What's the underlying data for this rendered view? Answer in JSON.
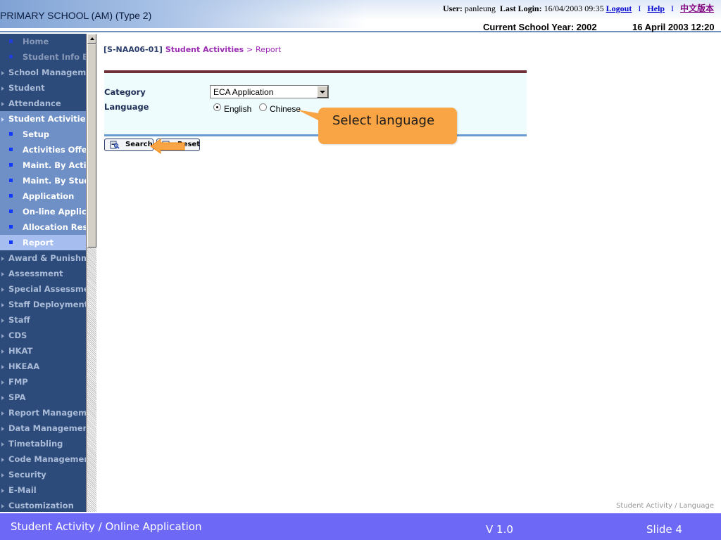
{
  "header": {
    "school_title": "PRIMARY SCHOOL (AM) (Type 2)",
    "user_label": "User:",
    "user_name": "panleung",
    "last_login_label": "Last Login:",
    "last_login_value": "16/04/2003 09:35",
    "logout": "Logout",
    "separator": "I",
    "help": "Help",
    "chinese_version": "中文版本",
    "current_school_year": "Current School Year: 2002",
    "date_time": "16 April 2003 12:20"
  },
  "sidebar": {
    "items": [
      {
        "label": "Home",
        "level": "sub",
        "state": "faded"
      },
      {
        "label": "Student Info Enqu",
        "level": "sub",
        "state": "faded"
      },
      {
        "label": "School Managemen",
        "level": "top",
        "state": "normal"
      },
      {
        "label": "Student",
        "level": "top",
        "state": "normal"
      },
      {
        "label": "Attendance",
        "level": "top",
        "state": "normal"
      },
      {
        "label": "Student Activities",
        "level": "top",
        "state": "active-group"
      },
      {
        "label": "Setup",
        "level": "sub",
        "state": "open-sub"
      },
      {
        "label": "Activities Offere",
        "level": "sub",
        "state": "open-sub"
      },
      {
        "label": "Maint. By Activit",
        "level": "sub",
        "state": "open-sub"
      },
      {
        "label": "Maint. By Studer",
        "level": "sub",
        "state": "open-sub"
      },
      {
        "label": "Application",
        "level": "sub",
        "state": "open-sub"
      },
      {
        "label": "On-line Applicat",
        "level": "sub",
        "state": "open-sub"
      },
      {
        "label": "Allocation Resul",
        "level": "sub",
        "state": "open-sub"
      },
      {
        "label": "Report",
        "level": "sub",
        "state": "current"
      },
      {
        "label": "Award & Punishme",
        "level": "top",
        "state": "normal"
      },
      {
        "label": "Assessment",
        "level": "top",
        "state": "normal"
      },
      {
        "label": "Special Assessmen",
        "level": "top",
        "state": "normal"
      },
      {
        "label": "Staff Deployment",
        "level": "top",
        "state": "normal"
      },
      {
        "label": "Staff",
        "level": "top",
        "state": "normal"
      },
      {
        "label": "CDS",
        "level": "top",
        "state": "normal"
      },
      {
        "label": "HKAT",
        "level": "top",
        "state": "normal"
      },
      {
        "label": "HKEAA",
        "level": "top",
        "state": "normal"
      },
      {
        "label": "FMP",
        "level": "top",
        "state": "normal"
      },
      {
        "label": "SPA",
        "level": "top",
        "state": "normal"
      },
      {
        "label": "Report Managemen",
        "level": "top",
        "state": "normal"
      },
      {
        "label": "Data Management",
        "level": "top",
        "state": "normal"
      },
      {
        "label": "Timetabling",
        "level": "top",
        "state": "normal"
      },
      {
        "label": "Code Management",
        "level": "top",
        "state": "normal"
      },
      {
        "label": "Security",
        "level": "top",
        "state": "normal"
      },
      {
        "label": "E-Mail",
        "level": "top",
        "state": "normal"
      },
      {
        "label": "Customization",
        "level": "top",
        "state": "normal"
      }
    ]
  },
  "breadcrumb": {
    "code": "[S-NAA06-01]",
    "module": "Student Activities",
    "separator": ">",
    "page": "Report"
  },
  "form": {
    "category_label": "Category",
    "category_value": "ECA Application",
    "language_label": "Language",
    "language_options": [
      {
        "label": "English",
        "checked": true
      },
      {
        "label": "Chinese",
        "checked": false
      }
    ]
  },
  "buttons": {
    "search": "Search",
    "reset": "Reset"
  },
  "callout": {
    "text": "Select language"
  },
  "slide_caption": "Student Activity / Language",
  "footer": {
    "title": "Student Activity / Online Application",
    "version": "V 1.0",
    "slide": "Slide 4"
  },
  "colors": {
    "sidebar_bg": "#2c4a7a",
    "sidebar_active": "#6f90c6",
    "sidebar_current": "#a6bdf0",
    "breadcrumb_module": "#9b2db3",
    "panel_bg": "#eefcfd",
    "panel_top_border": "#6e2f36",
    "panel_bottom_border": "#6a9bd0",
    "callout": "#f9a545",
    "footer_bg": "#6d68f6"
  },
  "icons": {
    "search_button": "magnifier-page-icon",
    "reset_button": "eraser-page-icon"
  }
}
